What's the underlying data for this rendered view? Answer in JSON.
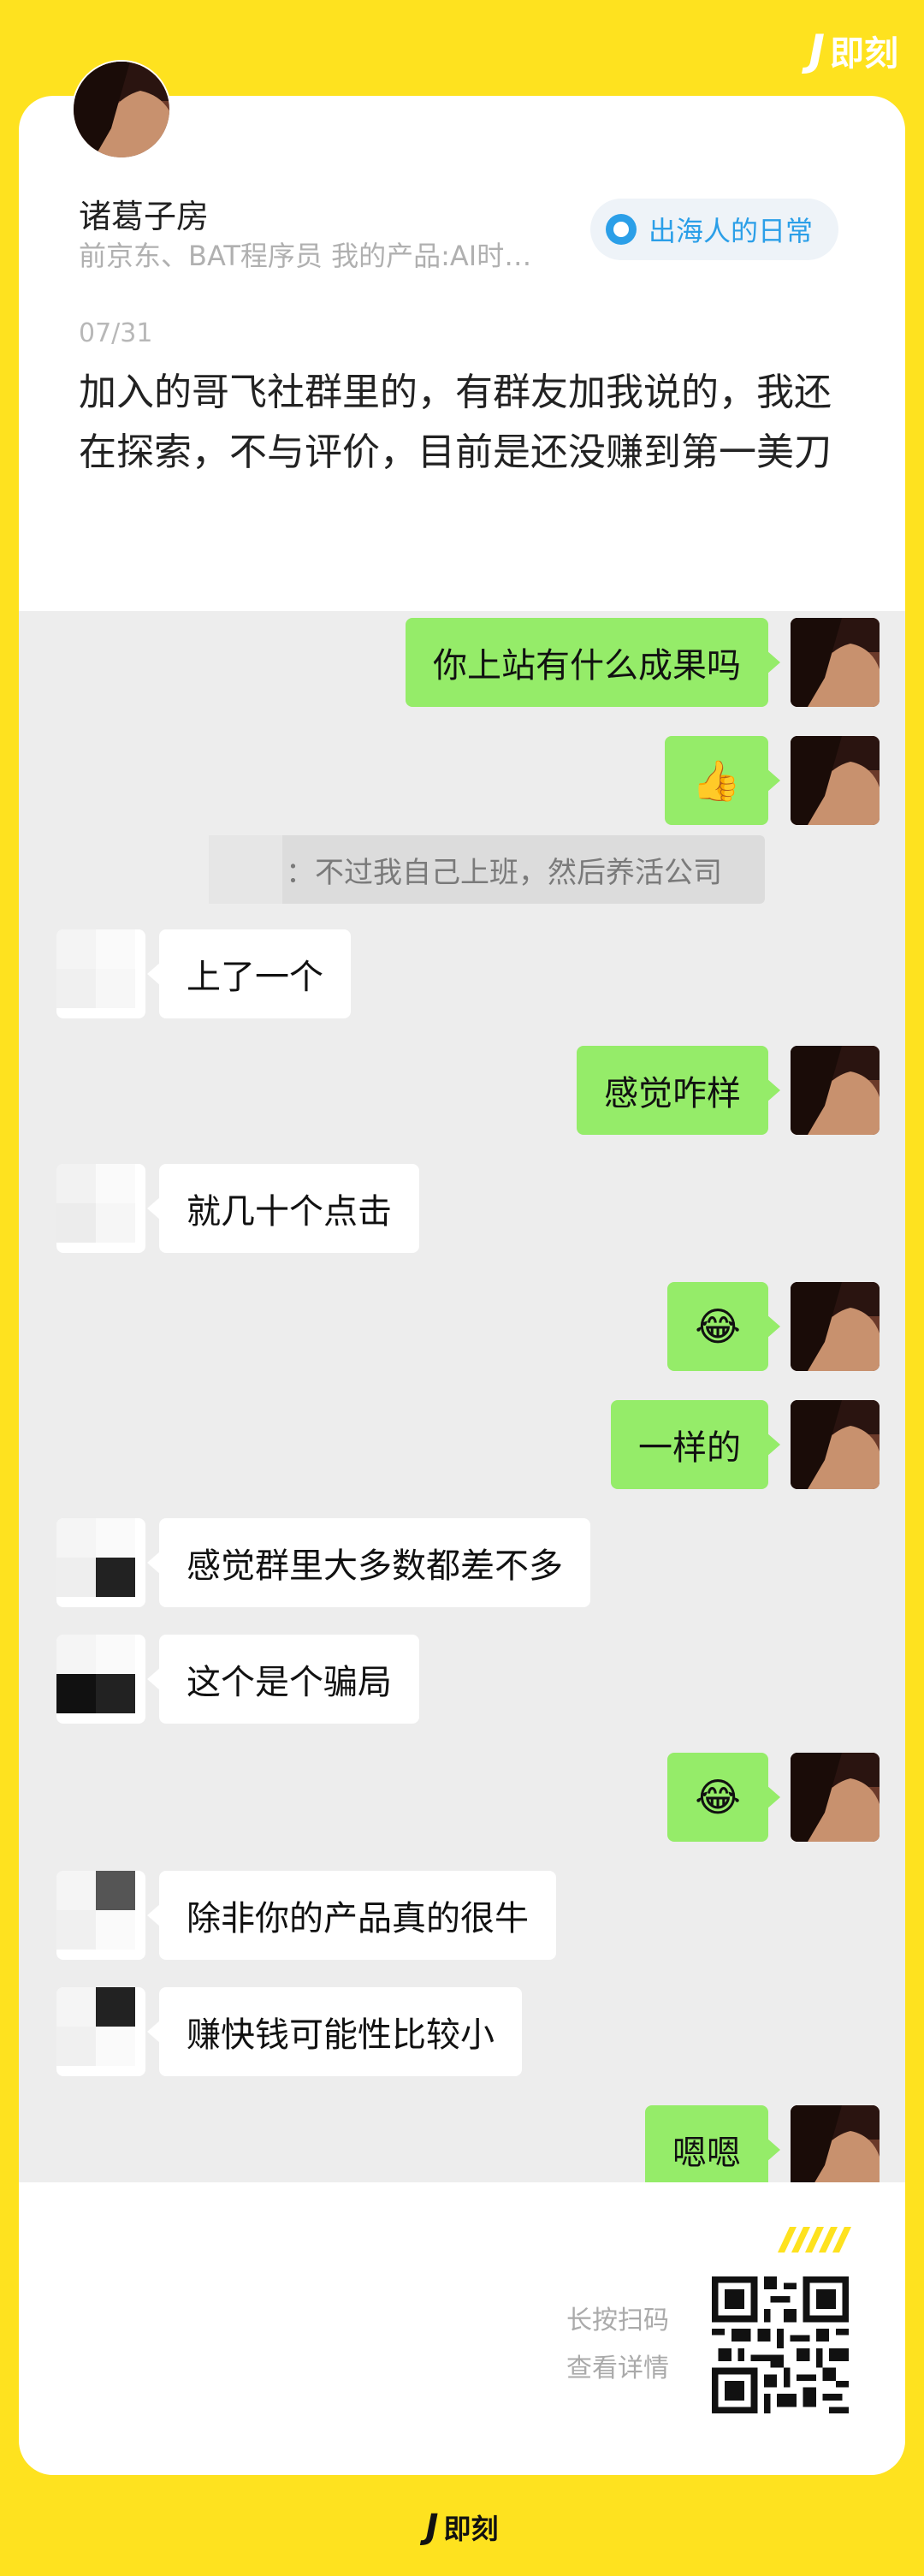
{
  "brand": {
    "name": "即刻",
    "mark": "J"
  },
  "post": {
    "author": "诸葛子房",
    "bio": "前京东、BAT程序员 我的产品:AI时…",
    "topic": "出海人的日常",
    "date": "07/31",
    "text": "加入的哥飞社群里的，有群友加我说的，我还在探索，不与评价，目前是还没赚到第一美刀"
  },
  "chat": {
    "messages": [
      {
        "side": "me",
        "text": "你上站有什么成果吗"
      },
      {
        "side": "me",
        "text": "👍"
      },
      {
        "side": "system",
        "text": "：不过我自己上班，然后养活公司"
      },
      {
        "side": "other",
        "text": "上了一个"
      },
      {
        "side": "me",
        "text": "感觉咋样"
      },
      {
        "side": "other",
        "text": "就几十个点击"
      },
      {
        "side": "me",
        "text": "😂"
      },
      {
        "side": "me",
        "text": "一样的"
      },
      {
        "side": "other",
        "text": "感觉群里大多数都差不多"
      },
      {
        "side": "other",
        "text": "这个是个骗局"
      },
      {
        "side": "me",
        "text": "😂"
      },
      {
        "side": "other",
        "text": "除非你的产品真的很牛"
      },
      {
        "side": "other",
        "text": "赚快钱可能性比较小"
      },
      {
        "side": "me",
        "text": "嗯嗯"
      }
    ]
  },
  "footer": {
    "scan_line1": "长按扫码",
    "scan_line2": "查看详情",
    "icon": "qr-code-icon"
  },
  "colors": {
    "background": "#FEE21F",
    "my_bubble": "#95EC69",
    "other_bubble": "#FFFFFF",
    "chat_background": "#EDEDED",
    "topic_accent": "#2B9FE8"
  }
}
